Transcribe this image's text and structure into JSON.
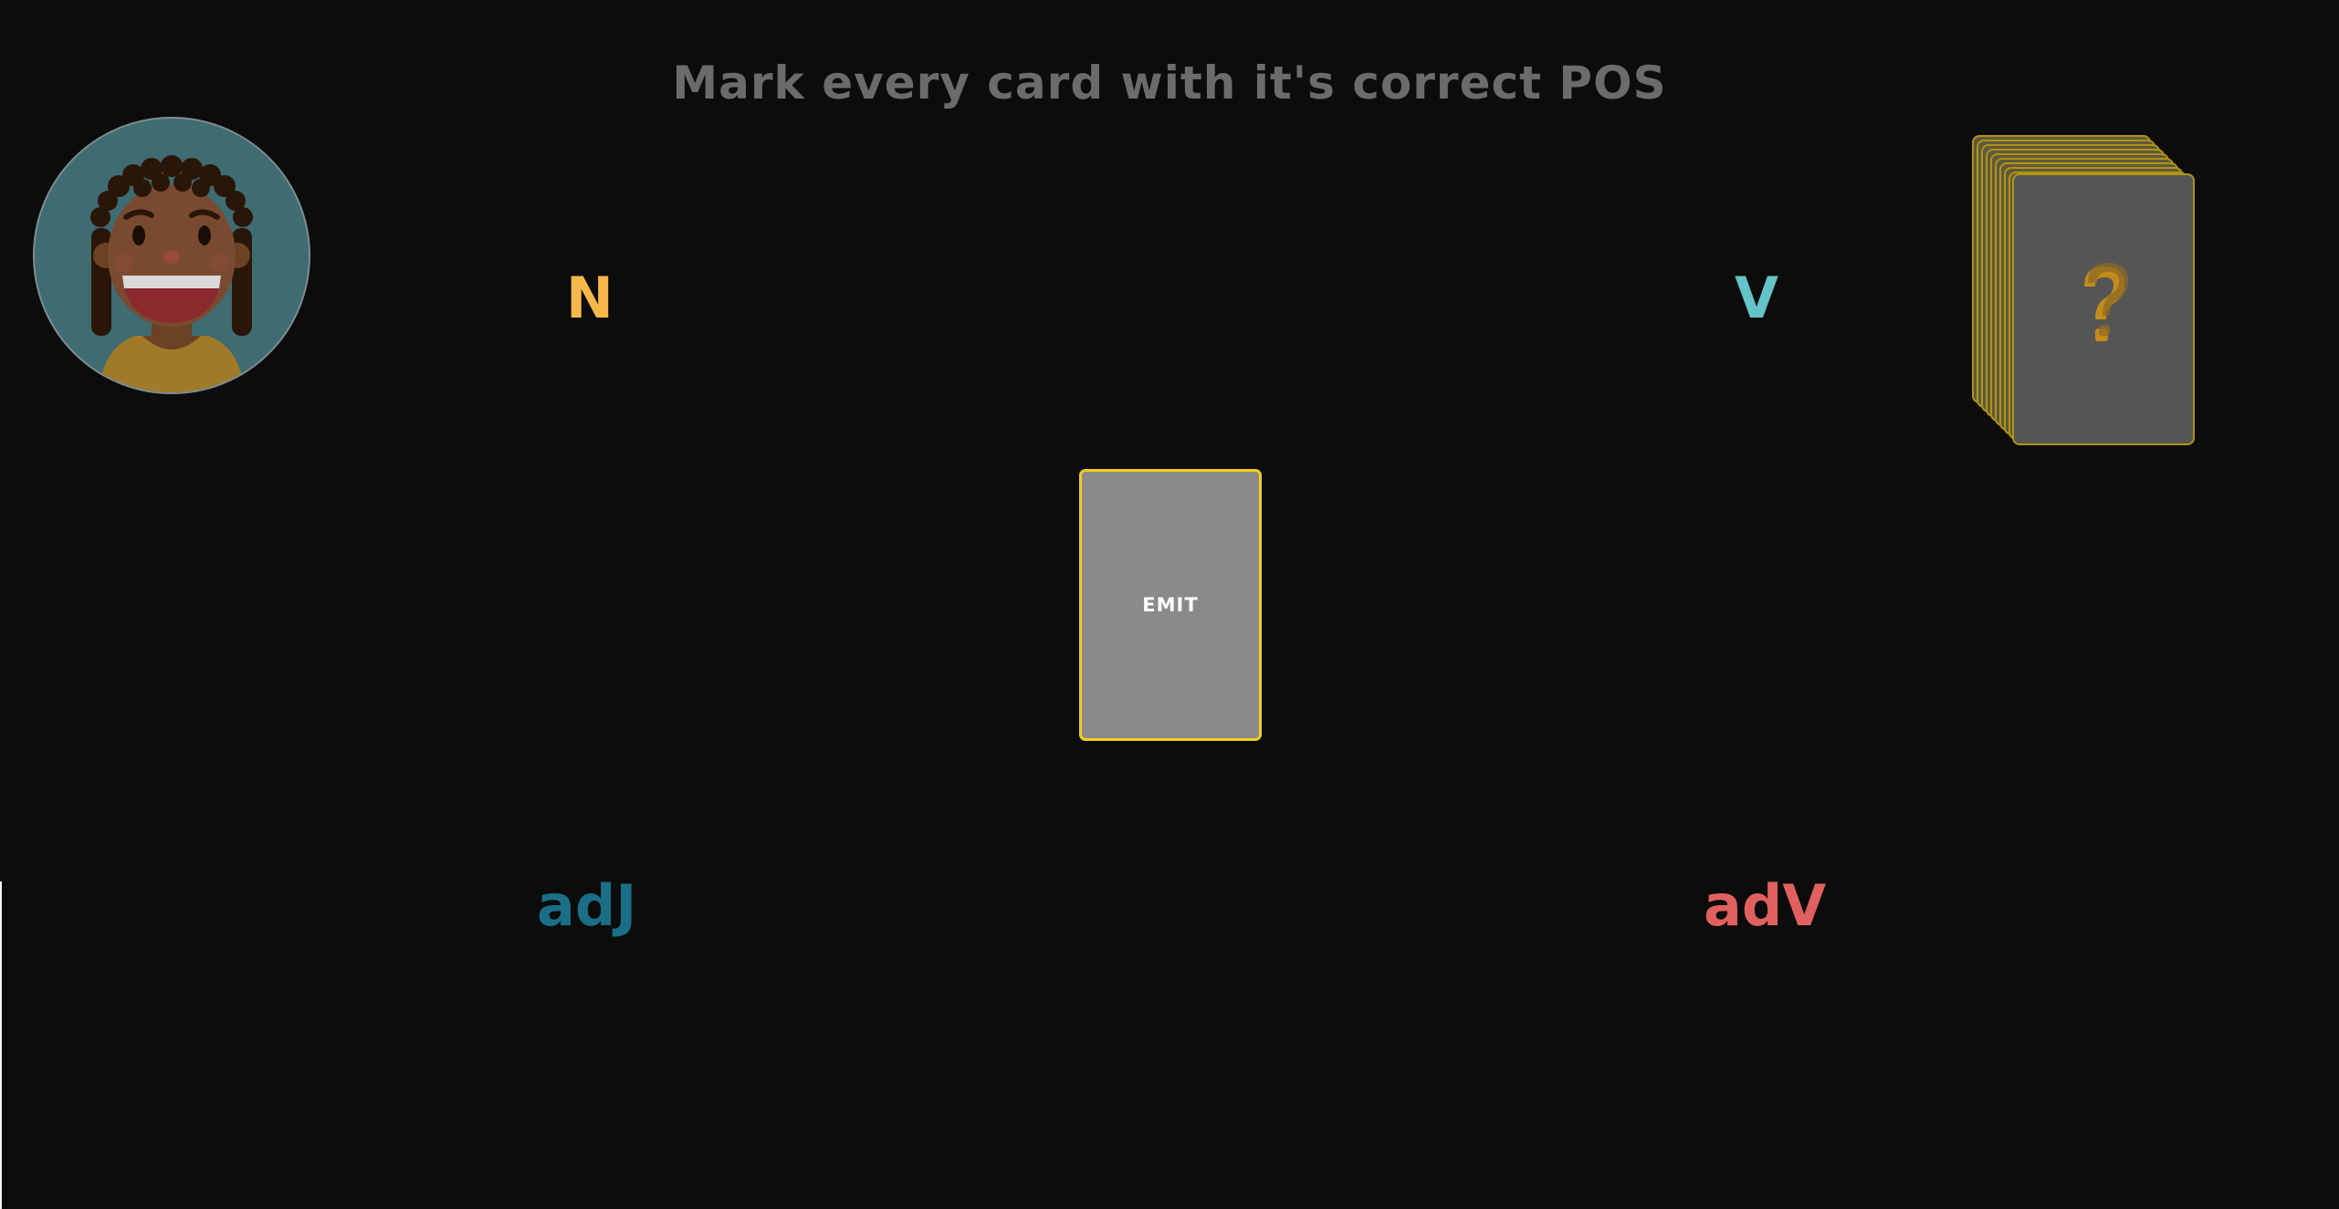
{
  "title": "Mark every card with it's correct POS",
  "avatar": {
    "icon": "smiling-girl-avatar-icon",
    "colors": {
      "background": "#3f6b72",
      "skin": "#7a4a30",
      "hair": "#2a1608",
      "shirt": "#b78a2a"
    }
  },
  "pos_labels": {
    "noun": "N",
    "verb": "V",
    "adjective": "adJ",
    "adverb": "adV"
  },
  "colors": {
    "noun": "#f7b84b",
    "verb": "#64c3c6",
    "adjective": "#1a6e86",
    "adverb": "#e06060",
    "card_border": "#f2cf1f",
    "background": "#0c0c0c"
  },
  "deck": {
    "icon": "question-mark-icon"
  },
  "current_card": {
    "word": "EMIT"
  }
}
